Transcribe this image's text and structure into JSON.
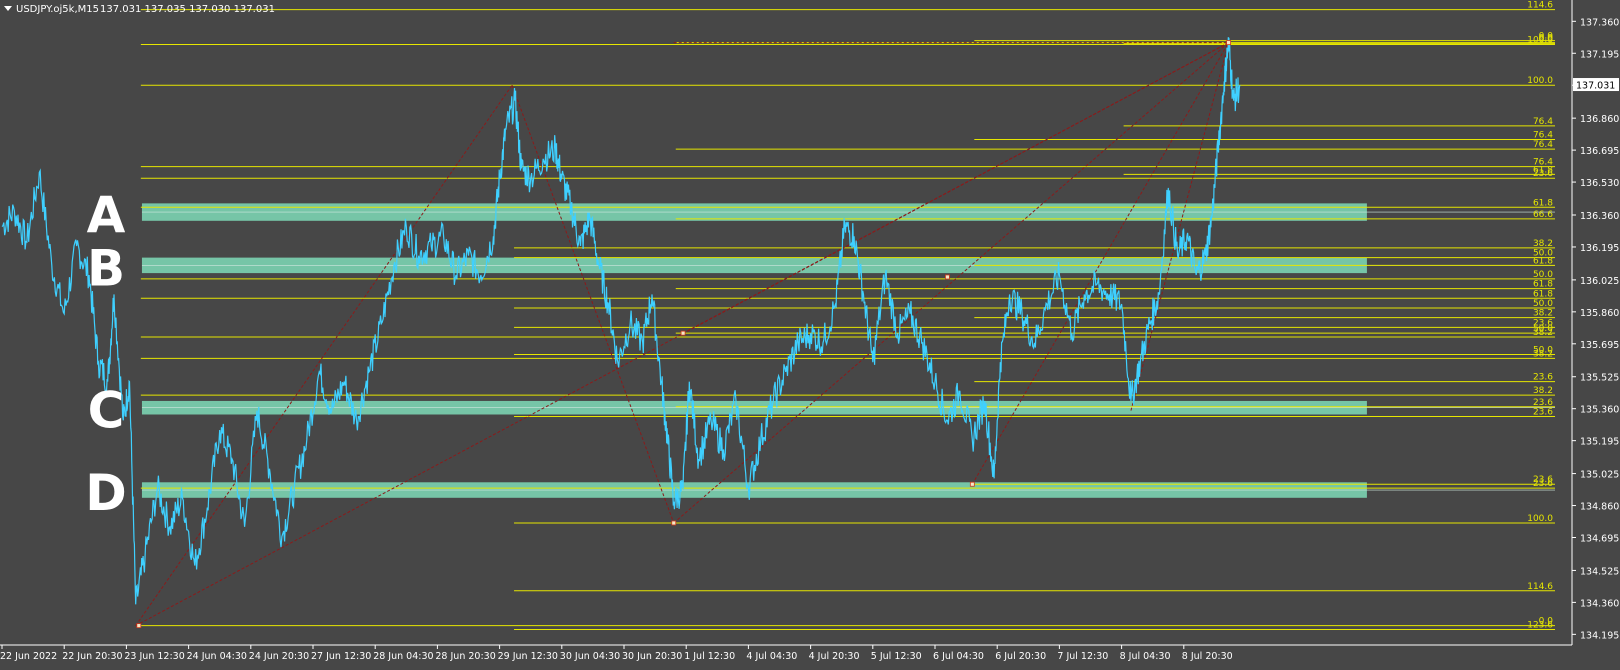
{
  "window": {
    "symbol_header": "USDJPY.oj5k,M15",
    "ohlc_text": "137.031 137.035 137.030 137.031"
  },
  "chart_data": {
    "type": "line",
    "title": "USDJPY.oj5k,M15",
    "price_axis": {
      "ylim": [
        134.14,
        137.47
      ],
      "ticks": [
        137.36,
        137.195,
        137.03,
        136.86,
        136.695,
        136.53,
        136.36,
        136.195,
        136.025,
        135.86,
        135.695,
        135.525,
        135.36,
        135.195,
        135.025,
        134.86,
        134.695,
        134.525,
        134.36,
        134.195
      ],
      "tick_labels": [
        "137.360",
        "137.195",
        "137.031",
        "136.860",
        "136.695",
        "136.530",
        "136.360",
        "136.195",
        "136.025",
        "135.860",
        "135.695",
        "135.525",
        "135.360",
        "135.195",
        "135.025",
        "134.860",
        "134.695",
        "134.525",
        "134.360",
        "134.195"
      ],
      "current_price": 137.031,
      "current_price_label": "137.031"
    },
    "time_axis": {
      "labels": [
        "22 Jun 2022",
        "22 Jun 20:30",
        "23 Jun 12:30",
        "24 Jun 04:30",
        "24 Jun 20:30",
        "27 Jun 12:30",
        "28 Jun 04:30",
        "28 Jun 20:30",
        "29 Jun 12:30",
        "30 Jun 04:30",
        "30 Jun 20:30",
        "1 Jul 12:30",
        "4 Jul 04:30",
        "4 Jul 20:30",
        "5 Jul 12:30",
        "6 Jul 04:30",
        "6 Jul 20:30",
        "7 Jul 12:30",
        "8 Jul 04:30",
        "8 Jul 20:30"
      ]
    },
    "price_series": {
      "name": "USDJPY",
      "color": "#3fd0ff",
      "points": [
        [
          0,
          136.3
        ],
        [
          0.2,
          136.38
        ],
        [
          0.4,
          136.22
        ],
        [
          0.6,
          136.58
        ],
        [
          0.8,
          136.1
        ],
        [
          1.0,
          135.85
        ],
        [
          1.2,
          136.2
        ],
        [
          1.4,
          136.05
        ],
        [
          1.55,
          135.6
        ],
        [
          1.7,
          135.5
        ],
        [
          1.8,
          135.95
        ],
        [
          1.95,
          135.3
        ],
        [
          2.05,
          135.5
        ],
        [
          2.15,
          134.35
        ],
        [
          2.3,
          134.6
        ],
        [
          2.5,
          134.95
        ],
        [
          2.7,
          134.75
        ],
        [
          2.9,
          134.9
        ],
        [
          3.1,
          134.55
        ],
        [
          3.3,
          134.85
        ],
        [
          3.5,
          135.25
        ],
        [
          3.7,
          135.1
        ],
        [
          3.9,
          134.75
        ],
        [
          4.1,
          135.35
        ],
        [
          4.3,
          135.05
        ],
        [
          4.5,
          134.7
        ],
        [
          4.7,
          134.95
        ],
        [
          4.9,
          135.2
        ],
        [
          5.1,
          135.55
        ],
        [
          5.3,
          135.35
        ],
        [
          5.5,
          135.5
        ],
        [
          5.7,
          135.3
        ],
        [
          5.9,
          135.55
        ],
        [
          6.1,
          135.8
        ],
        [
          6.3,
          136.1
        ],
        [
          6.5,
          136.3
        ],
        [
          6.7,
          136.15
        ],
        [
          6.9,
          136.2
        ],
        [
          7.1,
          136.25
        ],
        [
          7.3,
          136.05
        ],
        [
          7.5,
          136.15
        ],
        [
          7.7,
          136.05
        ],
        [
          7.9,
          136.25
        ],
        [
          8.0,
          136.55
        ],
        [
          8.1,
          136.8
        ],
        [
          8.25,
          136.95
        ],
        [
          8.35,
          136.6
        ],
        [
          8.5,
          136.55
        ],
        [
          8.7,
          136.65
        ],
        [
          8.9,
          136.7
        ],
        [
          9.0,
          136.55
        ],
        [
          9.15,
          136.4
        ],
        [
          9.3,
          136.2
        ],
        [
          9.45,
          136.35
        ],
        [
          9.6,
          136.1
        ],
        [
          9.75,
          135.9
        ],
        [
          9.9,
          135.6
        ],
        [
          10.1,
          135.8
        ],
        [
          10.3,
          135.7
        ],
        [
          10.45,
          135.95
        ],
        [
          10.6,
          135.5
        ],
        [
          10.7,
          135.2
        ],
        [
          10.8,
          134.88
        ],
        [
          10.95,
          134.95
        ],
        [
          11.05,
          135.5
        ],
        [
          11.2,
          135.1
        ],
        [
          11.4,
          135.3
        ],
        [
          11.6,
          135.15
        ],
        [
          11.8,
          135.4
        ],
        [
          12.0,
          134.95
        ],
        [
          12.2,
          135.2
        ],
        [
          12.4,
          135.4
        ],
        [
          12.6,
          135.55
        ],
        [
          12.8,
          135.7
        ],
        [
          13.0,
          135.75
        ],
        [
          13.2,
          135.7
        ],
        [
          13.4,
          135.9
        ],
        [
          13.55,
          136.3
        ],
        [
          13.7,
          136.25
        ],
        [
          13.85,
          135.95
        ],
        [
          14.0,
          135.6
        ],
        [
          14.2,
          136.05
        ],
        [
          14.4,
          135.75
        ],
        [
          14.6,
          135.85
        ],
        [
          14.8,
          135.7
        ],
        [
          15.0,
          135.5
        ],
        [
          15.2,
          135.3
        ],
        [
          15.4,
          135.45
        ],
        [
          15.6,
          135.2
        ],
        [
          15.8,
          135.4
        ],
        [
          15.95,
          135.0
        ],
        [
          16.05,
          135.6
        ],
        [
          16.2,
          135.95
        ],
        [
          16.4,
          135.85
        ],
        [
          16.6,
          135.7
        ],
        [
          16.8,
          135.9
        ],
        [
          17.0,
          136.05
        ],
        [
          17.2,
          135.75
        ],
        [
          17.4,
          135.95
        ],
        [
          17.6,
          136.0
        ],
        [
          17.8,
          135.95
        ],
        [
          18.0,
          135.9
        ],
        [
          18.15,
          135.4
        ],
        [
          18.3,
          135.6
        ],
        [
          18.45,
          135.8
        ],
        [
          18.6,
          135.95
        ],
        [
          18.75,
          136.5
        ],
        [
          18.9,
          136.15
        ],
        [
          19.05,
          136.25
        ],
        [
          19.2,
          136.05
        ],
        [
          19.35,
          136.15
        ],
        [
          19.45,
          136.35
        ],
        [
          19.55,
          136.7
        ],
        [
          19.65,
          137.05
        ],
        [
          19.72,
          137.25
        ],
        [
          19.8,
          136.95
        ],
        [
          19.9,
          137.031
        ]
      ]
    },
    "zones": [
      {
        "label": "A",
        "from": 136.33,
        "to": 136.42,
        "color": "#7fdcb8"
      },
      {
        "label": "B",
        "from": 136.06,
        "to": 136.14,
        "color": "#7fdcb8"
      },
      {
        "label": "C",
        "from": 135.33,
        "to": 135.4,
        "color": "#7fdcb8"
      },
      {
        "label": "D",
        "from": 134.9,
        "to": 134.98,
        "color": "#7fdcb8"
      }
    ],
    "fib_levels": [
      {
        "start": 2.2,
        "price": 137.42,
        "label": "114.6"
      },
      {
        "start": 2.2,
        "price": 137.24,
        "label": "100.0"
      },
      {
        "start": 10.8,
        "price": 137.25,
        "label": "0.0"
      },
      {
        "start": 15.6,
        "price": 137.26,
        "label": "0.0"
      },
      {
        "start": 18.0,
        "price": 137.245,
        "label": "0.0"
      },
      {
        "start": 2.2,
        "price": 137.03,
        "label": "100.0"
      },
      {
        "start": 18.0,
        "price": 136.82,
        "label": "76.4"
      },
      {
        "start": 15.6,
        "price": 136.75,
        "label": "76.4"
      },
      {
        "start": 10.8,
        "price": 136.7,
        "label": "76.4"
      },
      {
        "start": 2.2,
        "price": 136.61,
        "label": "76.4"
      },
      {
        "start": 18.0,
        "price": 136.57,
        "label": "61.8"
      },
      {
        "start": 2.2,
        "price": 136.55,
        "label": "23.6"
      },
      {
        "start": 2.2,
        "price": 136.4,
        "label": "61.8"
      },
      {
        "start": 10.8,
        "price": 136.34,
        "label": "66.6"
      },
      {
        "start": 8.2,
        "price": 136.19,
        "label": "38.2"
      },
      {
        "start": 8.2,
        "price": 136.14,
        "label": "50.0"
      },
      {
        "start": 15.6,
        "price": 136.1,
        "label": "61.8"
      },
      {
        "start": 2.2,
        "price": 136.03,
        "label": "50.0"
      },
      {
        "start": 10.8,
        "price": 135.98,
        "label": "61.8"
      },
      {
        "start": 2.2,
        "price": 135.93,
        "label": "61.8"
      },
      {
        "start": 8.2,
        "price": 135.88,
        "label": "50.0"
      },
      {
        "start": 15.6,
        "price": 135.83,
        "label": "38.2"
      },
      {
        "start": 8.2,
        "price": 135.78,
        "label": "23.6"
      },
      {
        "start": 10.8,
        "price": 135.75,
        "label": "50.0"
      },
      {
        "start": 2.2,
        "price": 135.73,
        "label": "38.2"
      },
      {
        "start": 8.2,
        "price": 135.64,
        "label": "50.0"
      },
      {
        "start": 2.2,
        "price": 135.62,
        "label": "38.2"
      },
      {
        "start": 15.6,
        "price": 135.5,
        "label": "23.6"
      },
      {
        "start": 2.2,
        "price": 135.43,
        "label": "38.2"
      },
      {
        "start": 10.8,
        "price": 135.37,
        "label": "23.6"
      },
      {
        "start": 8.2,
        "price": 135.32,
        "label": "23.6"
      },
      {
        "start": 15.6,
        "price": 134.97,
        "label": "23.6"
      },
      {
        "start": 2.2,
        "price": 134.95,
        "label": "23.6"
      },
      {
        "start": 8.2,
        "price": 134.77,
        "label": "100.0"
      },
      {
        "start": 8.2,
        "price": 134.42,
        "label": "114.6"
      },
      {
        "start": 2.2,
        "price": 134.24,
        "label": "0.0"
      },
      {
        "start": 8.2,
        "price": 134.22,
        "label": "123.6"
      }
    ],
    "trendlines": [
      {
        "from": [
          2.15,
          134.24
        ],
        "to": [
          8.2,
          137.03
        ]
      },
      {
        "from": [
          8.2,
          137.03
        ],
        "to": [
          10.8,
          134.77
        ]
      },
      {
        "from": [
          2.15,
          134.24
        ],
        "to": [
          19.72,
          137.25
        ]
      },
      {
        "from": [
          10.8,
          134.77
        ],
        "to": [
          19.72,
          137.25
        ]
      },
      {
        "from": [
          10.95,
          135.75
        ],
        "to": [
          19.72,
          137.25
        ]
      },
      {
        "from": [
          15.6,
          134.97
        ],
        "to": [
          19.72,
          137.25
        ]
      },
      {
        "from": [
          18.15,
          135.35
        ],
        "to": [
          19.72,
          137.25
        ]
      },
      {
        "from": [
          10.8,
          137.25
        ],
        "to": [
          19.72,
          137.25
        ]
      }
    ],
    "pivot_markers": [
      {
        "x": 2.2,
        "y": 134.24
      },
      {
        "x": 10.8,
        "y": 134.77
      },
      {
        "x": 10.95,
        "y": 135.75
      },
      {
        "x": 15.2,
        "y": 136.04
      },
      {
        "x": 15.6,
        "y": 134.97
      },
      {
        "x": 19.72,
        "y": 137.25
      }
    ],
    "colors": {
      "background": "#474747",
      "fib_line": "#e6e600",
      "fib_label": "#e6e600",
      "trend_line": "#8b1a1a",
      "axis_text": "#ffffff",
      "zone_label": "#ffffff"
    }
  }
}
